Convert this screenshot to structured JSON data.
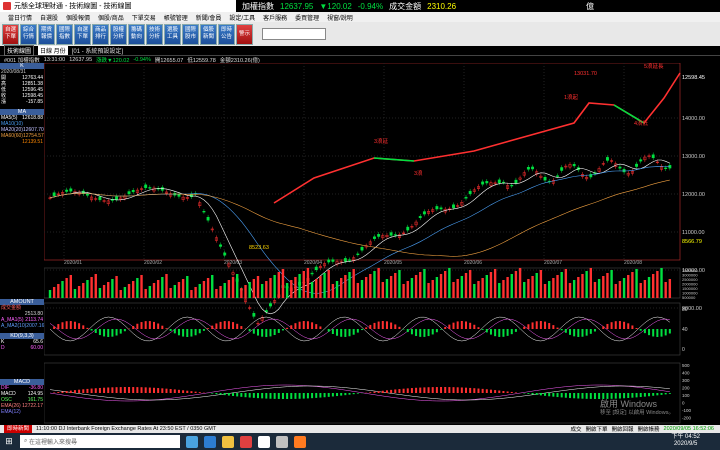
{
  "titlebar": {
    "app_title": "元態全球理財通 - 技術線圖 - 技術線圖"
  },
  "ticker": {
    "name": "加權指數",
    "price": "12637.95",
    "change": "▼120.02",
    "pct": "-0.94%",
    "vol_label": "成交金額",
    "vol": "2310.26",
    "unit": "億"
  },
  "menu": [
    "當日行情",
    "自選股",
    "個股報價",
    "個股/商品",
    "下單交易",
    "帳號管理",
    "新聞/會員",
    "設定/工具",
    "客戶服務",
    "委買管理",
    "視窗/說明"
  ],
  "toolbar": [
    {
      "l1": "自選",
      "l2": "下單"
    },
    {
      "l1": "綜合",
      "l2": "行情"
    },
    {
      "l1": "期貨",
      "l2": "報價"
    },
    {
      "l1": "國際",
      "l2": "指數"
    },
    {
      "l1": "自選",
      "l2": "下單"
    },
    {
      "l1": "商品",
      "l2": "排行"
    },
    {
      "l1": "股權",
      "l2": "分析"
    },
    {
      "l1": "籌碼",
      "l2": "動向"
    },
    {
      "l1": "技術",
      "l2": "分析"
    },
    {
      "l1": "選股",
      "l2": "工具"
    },
    {
      "l1": "國際",
      "l2": "股市"
    },
    {
      "l1": "個股",
      "l2": "新聞"
    },
    {
      "l1": "即時",
      "l2": "公告"
    },
    {
      "l1": "警示",
      "l2": ""
    }
  ],
  "subhead": {
    "label": "技術線圖",
    "period": "日線 月份",
    "code_desc": "[01 - 系統預設設定]"
  },
  "infoline": {
    "symbol": "#001 加權指數",
    "time": "13:31:00",
    "price": "12637.95",
    "change": "漲跌▼120.02",
    "pct": "-0.94%",
    "open": "開12655.07",
    "low": "低12559.78",
    "amount": "金額2310.26(億)"
  },
  "left": {
    "date": "2020/08/31",
    "ohlc": [
      [
        "開",
        "12763.44"
      ],
      [
        "高",
        "12851.38"
      ],
      [
        "低",
        "12596.45"
      ],
      [
        "收",
        "12598.45"
      ],
      [
        "漲",
        "-157.85"
      ]
    ],
    "ma_label": "MA",
    "ma": [
      [
        "MA5(5)",
        "12618.88"
      ],
      [
        "MA10(10)",
        ""
      ],
      [
        "MA20(20)",
        "12607.70"
      ],
      [
        "MA60(60)",
        "12754.57"
      ]
    ],
    "ma_extra": "12139.51",
    "amount_label": "AMOUNT",
    "amount": [
      [
        "成交金額",
        ""
      ],
      [
        "",
        "2513.80"
      ],
      [
        "A_MA1(5)",
        "2113.74"
      ],
      [
        "A_MA2(10)",
        "2007.16"
      ]
    ],
    "kd_label": "KD(9,3,3)",
    "kd": [
      [
        "K",
        "65.6"
      ],
      [
        "D",
        "60.00"
      ]
    ],
    "macd_label": "MACD",
    "macd": [
      [
        "DIF",
        "-36.80"
      ],
      [
        "MACD",
        "124.95"
      ],
      [
        "OSC",
        "161.75"
      ]
    ],
    "ema": [
      [
        "EMA(26)",
        "12722.17"
      ],
      [
        "EMA(12)",
        ""
      ]
    ]
  },
  "chart": {
    "price_axis": [
      "14000.00",
      "13000.00",
      "12000.00",
      "11000.00",
      "10000.00",
      "9000.00"
    ],
    "price_last": "12598.45",
    "price_ref": "8566.79",
    "dates": [
      "2020/01",
      "2020/02",
      "2020/03",
      "2020/04",
      "2020/05",
      "2020/06",
      "2020/07",
      "2020/08"
    ],
    "low_label": "8523.63",
    "high_label": "13031.70",
    "annotations": [
      {
        "text": "5浪延長",
        "color": "#ff3030"
      },
      {
        "text": "3浪延",
        "color": "#ff3030"
      },
      {
        "text": "1浪起",
        "color": "#ff3030"
      },
      {
        "text": "4浪低",
        "color": "#ff3030"
      },
      {
        "text": "3浪",
        "color": "#ff3030"
      }
    ],
    "vol_axis": [
      "3500000",
      "3000000",
      "2500000",
      "2000000",
      "1500000",
      "1000000",
      "500000"
    ],
    "kd_axis": [
      "80",
      "40",
      "0"
    ],
    "macd_axis": [
      "500",
      "400",
      "300",
      "200",
      "100",
      "0",
      "-100",
      "-200"
    ]
  },
  "status": {
    "left": "即時新聞",
    "news": "11:10:00 DJ Interbank Foreign Exchange Rates At 23:50 EST / 0350 GMT",
    "items": [
      "成交",
      "開啟下單",
      "開啟回報",
      "開啟帳務"
    ],
    "datetime": "2020/09/05 16:52:06"
  },
  "taskbar": {
    "search": "在這裡輸入來搜尋",
    "time": "下午 04:52",
    "date": "2020/9/5"
  },
  "watermark": {
    "line1": "啟用 Windows",
    "line2": "移至 [設定] 以啟用 Windows。"
  }
}
